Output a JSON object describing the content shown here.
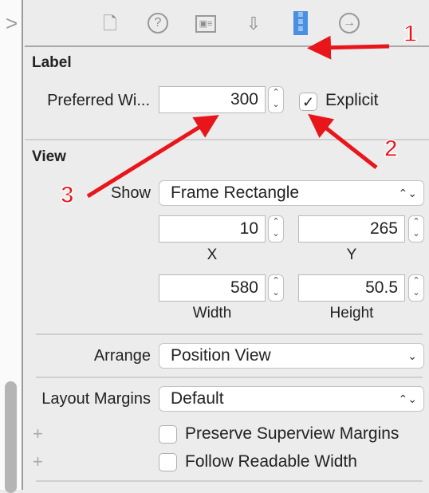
{
  "toolbar": {
    "icons": [
      "file-icon",
      "help-icon",
      "identity-icon",
      "attributes-icon",
      "size-ruler-icon",
      "connections-icon"
    ],
    "active": "size-ruler-icon",
    "accent": "#4a90e2"
  },
  "label_section": {
    "title": "Label",
    "preferred_width_label": "Preferred Wi...",
    "preferred_width_value": "300",
    "explicit_label": "Explicit",
    "explicit_checked": true
  },
  "view_section": {
    "title": "View",
    "show_label": "Show",
    "show_value": "Frame Rectangle",
    "x_value": "10",
    "x_label": "X",
    "y_value": "265",
    "y_label": "Y",
    "width_value": "580",
    "width_label": "Width",
    "height_value": "50.5",
    "height_label": "Height",
    "arrange_label": "Arrange",
    "arrange_value": "Position View",
    "layout_margins_label": "Layout Margins",
    "layout_margins_value": "Default",
    "preserve_label": "Preserve Superview Margins",
    "preserve_checked": false,
    "readable_label": "Follow Readable Width",
    "readable_checked": false
  },
  "annotations": {
    "color": "#e8161b",
    "n1": "1",
    "n2": "2",
    "n3": "3"
  }
}
